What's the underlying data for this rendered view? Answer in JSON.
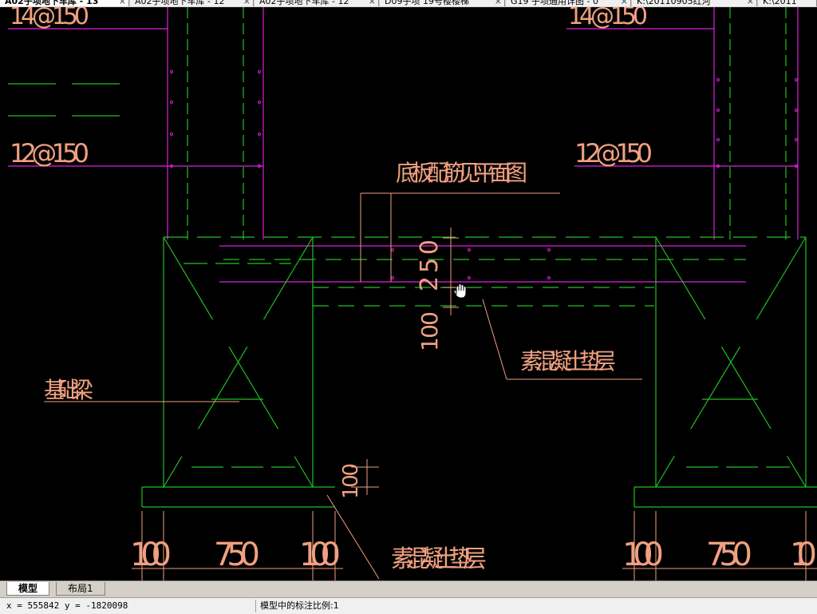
{
  "tabs": [
    {
      "label": "A02子项地下车库 - 13",
      "active": true
    },
    {
      "label": "A02子项地下车库 - 12",
      "active": false
    },
    {
      "label": "A02子项地下车库 - 12",
      "active": false
    },
    {
      "label": "D09子项 19号楼楼梯",
      "active": false
    },
    {
      "label": "G19 子项通用详图 - 0",
      "active": false
    },
    {
      "label": "K:\\20110905红河",
      "active": false
    },
    {
      "label": "K:\\2011",
      "active": false
    }
  ],
  "drawing": {
    "rebar_top_left": "14@150",
    "rebar_top_right": "14@150",
    "rebar_mid_left": "12@150",
    "rebar_mid_right": "12@150",
    "slab_note": "底板配筋见平面图",
    "dim_250": "250",
    "dim_100_vertical": "100",
    "cushion_label_1": "素混凝土垫层",
    "beam_label": "基础梁",
    "dim_100_small": "100",
    "dims_bottom_left": [
      "100",
      "750",
      "100"
    ],
    "dims_bottom_right": [
      "100",
      "750",
      "10"
    ],
    "cushion_label_2": "素混凝土垫层"
  },
  "layout_tabs": [
    "模型",
    "布局1"
  ],
  "status": {
    "coordinates": "x = 555842  y = -1820098",
    "annotation_scale": "模型中的标注比例:1"
  },
  "colors": {
    "background": "#000000",
    "rebar_magenta": "#e020e0",
    "structure_green": "#20c020",
    "text_salmon": "#f0a080"
  }
}
